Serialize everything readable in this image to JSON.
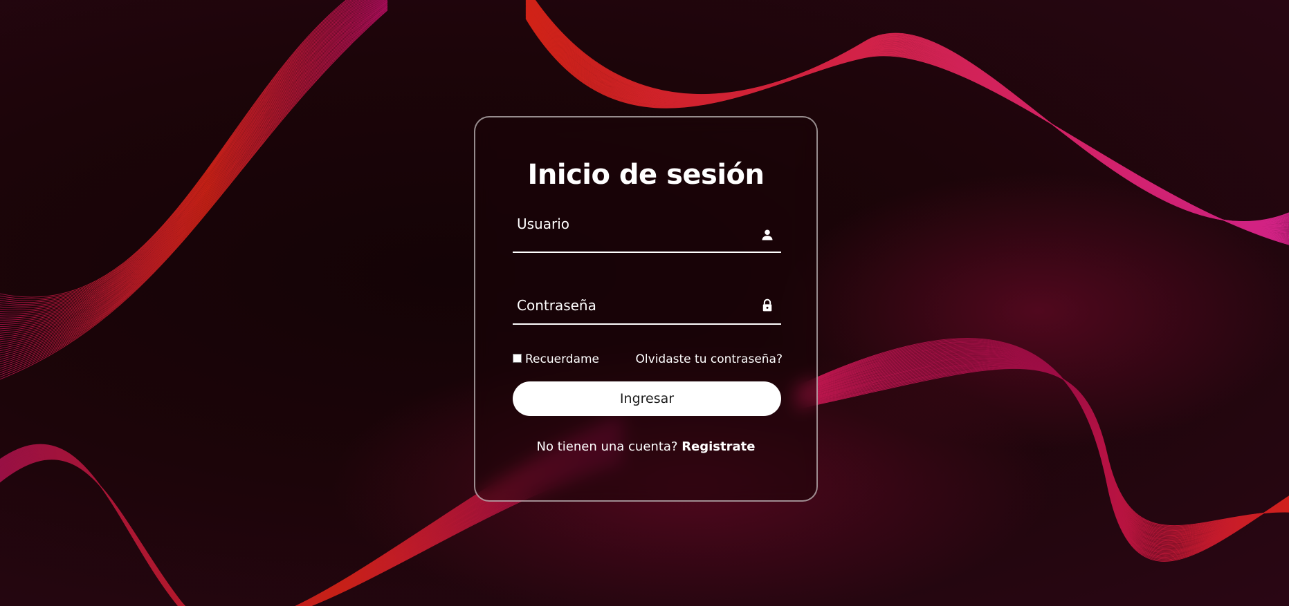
{
  "login": {
    "title": "Inicio de sesión",
    "username_label": "Usuario",
    "password_label": "Contraseña",
    "username_value": "",
    "password_value": "",
    "username_icon": "user-icon",
    "password_icon": "lock-icon",
    "remember_label": "Recuerdame",
    "remember_checked": false,
    "forgot_label": "Olvidaste tu contraseña?",
    "submit_label": "Ingresar",
    "register_prompt": "No tienen una cuenta?",
    "register_link": "Registrate"
  },
  "colors": {
    "background": "#1a0508",
    "wave_red": "#ff2a1a",
    "wave_pink": "#ff2aa8",
    "card_border": "#ffffff",
    "button_bg": "#ffffff"
  }
}
